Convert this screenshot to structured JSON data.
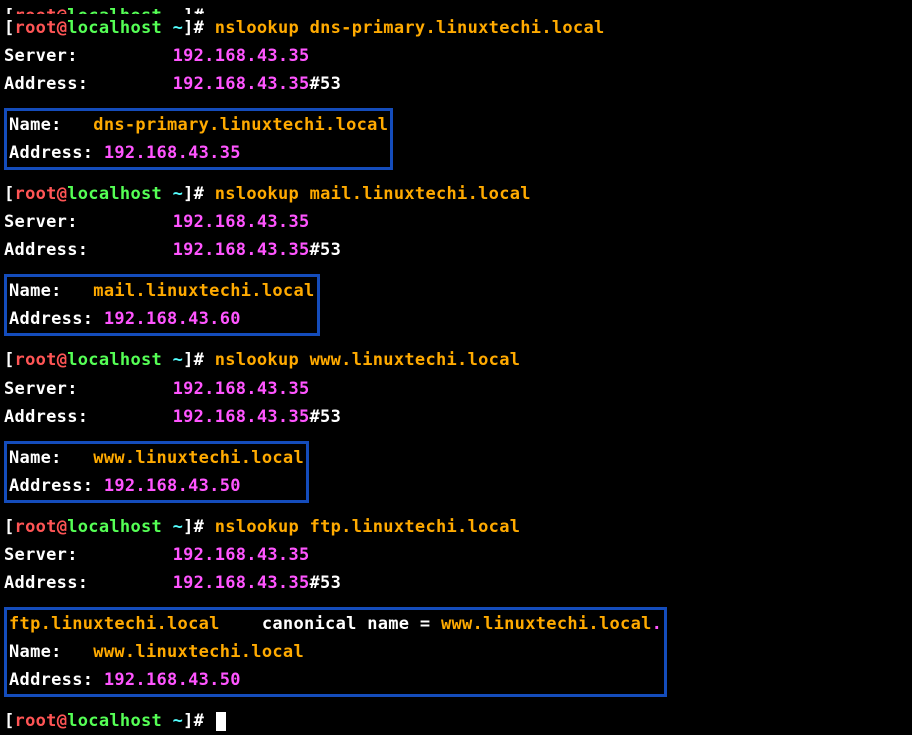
{
  "prompt": {
    "user": "root",
    "at": "@",
    "host": "localhost",
    "path": " ~",
    "end": "]# "
  },
  "lookups": [
    {
      "cmd": "nslookup dns-primary.linuxtechi.local",
      "server_label": "Server:         ",
      "server_ip": "192.168.43.35",
      "address_label": "Address:        ",
      "address_ip": "192.168.43.35",
      "port": "#53",
      "box": {
        "name_label": "Name:   ",
        "name_value": "dns-primary.linuxtechi.local",
        "addr_label": "Address: ",
        "addr_value": "192.168.43.35"
      }
    },
    {
      "cmd": "nslookup mail.linuxtechi.local",
      "server_label": "Server:         ",
      "server_ip": "192.168.43.35",
      "address_label": "Address:        ",
      "address_ip": "192.168.43.35",
      "port": "#53",
      "box": {
        "name_label": "Name:   ",
        "name_value": "mail.linuxtechi.local",
        "addr_label": "Address: ",
        "addr_value": "192.168.43.60"
      }
    },
    {
      "cmd": "nslookup www.linuxtechi.local",
      "server_label": "Server:         ",
      "server_ip": "192.168.43.35",
      "address_label": "Address:        ",
      "address_ip": "192.168.43.35",
      "port": "#53",
      "box": {
        "name_label": "Name:   ",
        "name_value": "www.linuxtechi.local",
        "addr_label": "Address: ",
        "addr_value": "192.168.43.50"
      }
    },
    {
      "cmd": "nslookup ftp.linuxtechi.local",
      "server_label": "Server:         ",
      "server_ip": "192.168.43.35",
      "address_label": "Address:        ",
      "address_ip": "192.168.43.35",
      "port": "#53",
      "box": {
        "cname_pre": "ftp.linuxtechi.local",
        "cname_mid": "    canonical name = ",
        "cname_post": "www.linuxtechi.local",
        "cname_dot": ".",
        "name_label": "Name:   ",
        "name_value": "www.linuxtechi.local",
        "addr_label": "Address: ",
        "addr_value": "192.168.43.50"
      }
    }
  ],
  "final_prompt": true
}
